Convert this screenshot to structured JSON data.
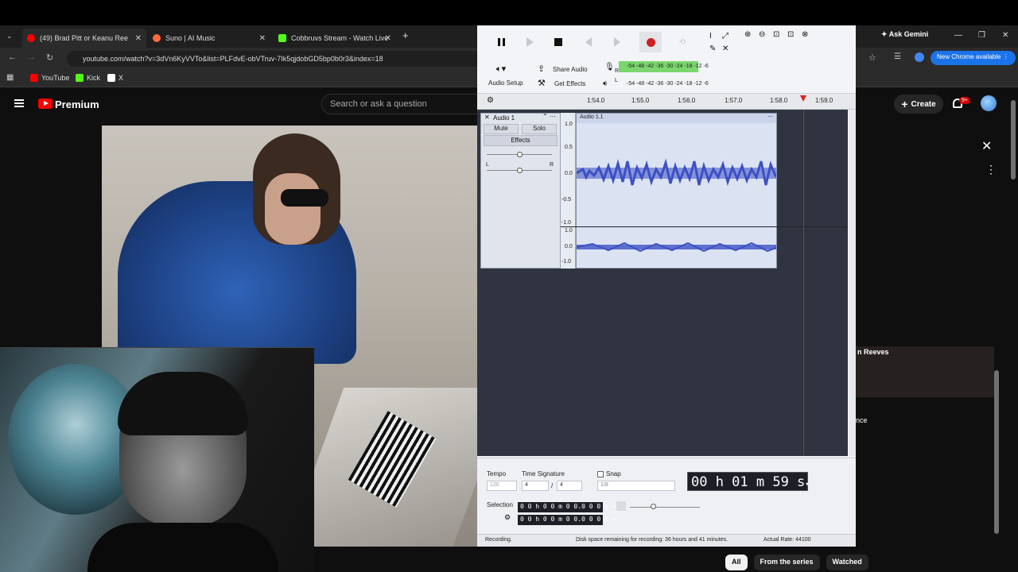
{
  "browser": {
    "tabs": [
      {
        "label": "(49) Brad Pitt or Keanu Ree",
        "favicon_color": "#ff0000"
      },
      {
        "label": "Suno | AI Music",
        "favicon_color": "#ff6a3d"
      },
      {
        "label": "Cobbruvs Stream - Watch Live",
        "favicon_color": "#53fc18"
      }
    ],
    "url": "youtube.com/watch?v=3dVn6KyVVTo&list=PLFdvE-obVTruv-7Ik5qjdobGD5bp0b0r3&index=18",
    "bookmarks": [
      "YouTube",
      "Kick",
      "X"
    ],
    "ask_gemini": "Ask Gemini",
    "new_chrome": "New Chrome available"
  },
  "youtube": {
    "logo_text": "Premium",
    "search_placeholder": "Search or ask a question",
    "create_label": "Create",
    "notif_badge": "9+",
    "side_item_1": "n Reeves",
    "side_item_2": "nce",
    "chips": [
      "All",
      "From the series",
      "Watched"
    ]
  },
  "audacity": {
    "audio_setup": "Audio Setup",
    "share_audio": "Share Audio",
    "get_effects": "Get Effects",
    "meter_rec_ticks": "-54  -48  -42  -36  -30  -24  -18  -12  -6",
    "meter_play_ticks": "-54  -48  -42  -36  -30  -24  -18  -12  -6",
    "meter_l": "L",
    "meter_r": "R",
    "ruler": [
      "1:54.0",
      "1:55.0",
      "1:56.0",
      "1:57.0",
      "1:58.0",
      "1:59.0"
    ],
    "track_name": "Audio 1",
    "clip_name": "Audio 1.1",
    "mute": "Mute",
    "solo": "Solo",
    "effects": "Effects",
    "pan_l": "L",
    "pan_r": "R",
    "scale_top": [
      "1.0",
      "0.5",
      "0.0",
      "-0.5",
      "-1.0"
    ],
    "scale_bottom": [
      "1.0",
      "0.0",
      "-1.0"
    ],
    "tempo_label": "Tempo",
    "tempo_value": "120",
    "time_sig_label": "Time Signature",
    "time_sig_num": "4",
    "time_sig_den": "4",
    "snap_label": "Snap",
    "snap_value": "1/8",
    "time_display": "00 h 01 m 59 s",
    "selection_label": "Selection",
    "sel_start": "0 0 h 0 0 m 0 0.0 0 0 s",
    "sel_end": "0 0 h 0 0 m 0 0.0 0 0 s",
    "status_left": "Recording.",
    "status_mid": "Disk space remaining for recording: 36 hours and 41 minutes.",
    "status_right": "Actual Rate: 44100"
  }
}
